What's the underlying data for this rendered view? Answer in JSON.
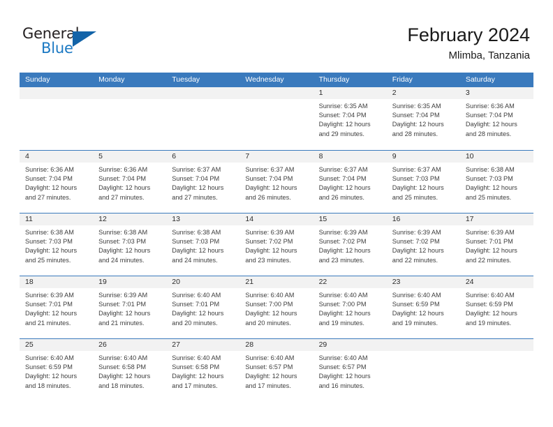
{
  "brand": {
    "name_top": "General",
    "name_bottom": "Blue",
    "triangle_icon": "triangle-icon",
    "color_dark": "#231f20",
    "color_blue": "#1b79c3"
  },
  "header": {
    "title": "February 2024",
    "subtitle": "Mlimba, Tanzania"
  },
  "theme": {
    "header_bg": "#3a7abd",
    "header_text": "#ffffff",
    "day_band_bg": "#f2f2f2",
    "cell_bg": "#ffffff",
    "grid_line": "#3a7abd"
  },
  "weekdays": [
    "Sunday",
    "Monday",
    "Tuesday",
    "Wednesday",
    "Thursday",
    "Friday",
    "Saturday"
  ],
  "weeks": [
    [
      {
        "day": "",
        "lines": []
      },
      {
        "day": "",
        "lines": []
      },
      {
        "day": "",
        "lines": []
      },
      {
        "day": "",
        "lines": []
      },
      {
        "day": "1",
        "lines": [
          "Sunrise: 6:35 AM",
          "Sunset: 7:04 PM",
          "Daylight: 12 hours",
          "and 29 minutes."
        ]
      },
      {
        "day": "2",
        "lines": [
          "Sunrise: 6:35 AM",
          "Sunset: 7:04 PM",
          "Daylight: 12 hours",
          "and 28 minutes."
        ]
      },
      {
        "day": "3",
        "lines": [
          "Sunrise: 6:36 AM",
          "Sunset: 7:04 PM",
          "Daylight: 12 hours",
          "and 28 minutes."
        ]
      }
    ],
    [
      {
        "day": "4",
        "lines": [
          "Sunrise: 6:36 AM",
          "Sunset: 7:04 PM",
          "Daylight: 12 hours",
          "and 27 minutes."
        ]
      },
      {
        "day": "5",
        "lines": [
          "Sunrise: 6:36 AM",
          "Sunset: 7:04 PM",
          "Daylight: 12 hours",
          "and 27 minutes."
        ]
      },
      {
        "day": "6",
        "lines": [
          "Sunrise: 6:37 AM",
          "Sunset: 7:04 PM",
          "Daylight: 12 hours",
          "and 27 minutes."
        ]
      },
      {
        "day": "7",
        "lines": [
          "Sunrise: 6:37 AM",
          "Sunset: 7:04 PM",
          "Daylight: 12 hours",
          "and 26 minutes."
        ]
      },
      {
        "day": "8",
        "lines": [
          "Sunrise: 6:37 AM",
          "Sunset: 7:04 PM",
          "Daylight: 12 hours",
          "and 26 minutes."
        ]
      },
      {
        "day": "9",
        "lines": [
          "Sunrise: 6:37 AM",
          "Sunset: 7:03 PM",
          "Daylight: 12 hours",
          "and 25 minutes."
        ]
      },
      {
        "day": "10",
        "lines": [
          "Sunrise: 6:38 AM",
          "Sunset: 7:03 PM",
          "Daylight: 12 hours",
          "and 25 minutes."
        ]
      }
    ],
    [
      {
        "day": "11",
        "lines": [
          "Sunrise: 6:38 AM",
          "Sunset: 7:03 PM",
          "Daylight: 12 hours",
          "and 25 minutes."
        ]
      },
      {
        "day": "12",
        "lines": [
          "Sunrise: 6:38 AM",
          "Sunset: 7:03 PM",
          "Daylight: 12 hours",
          "and 24 minutes."
        ]
      },
      {
        "day": "13",
        "lines": [
          "Sunrise: 6:38 AM",
          "Sunset: 7:03 PM",
          "Daylight: 12 hours",
          "and 24 minutes."
        ]
      },
      {
        "day": "14",
        "lines": [
          "Sunrise: 6:39 AM",
          "Sunset: 7:02 PM",
          "Daylight: 12 hours",
          "and 23 minutes."
        ]
      },
      {
        "day": "15",
        "lines": [
          "Sunrise: 6:39 AM",
          "Sunset: 7:02 PM",
          "Daylight: 12 hours",
          "and 23 minutes."
        ]
      },
      {
        "day": "16",
        "lines": [
          "Sunrise: 6:39 AM",
          "Sunset: 7:02 PM",
          "Daylight: 12 hours",
          "and 22 minutes."
        ]
      },
      {
        "day": "17",
        "lines": [
          "Sunrise: 6:39 AM",
          "Sunset: 7:01 PM",
          "Daylight: 12 hours",
          "and 22 minutes."
        ]
      }
    ],
    [
      {
        "day": "18",
        "lines": [
          "Sunrise: 6:39 AM",
          "Sunset: 7:01 PM",
          "Daylight: 12 hours",
          "and 21 minutes."
        ]
      },
      {
        "day": "19",
        "lines": [
          "Sunrise: 6:39 AM",
          "Sunset: 7:01 PM",
          "Daylight: 12 hours",
          "and 21 minutes."
        ]
      },
      {
        "day": "20",
        "lines": [
          "Sunrise: 6:40 AM",
          "Sunset: 7:01 PM",
          "Daylight: 12 hours",
          "and 20 minutes."
        ]
      },
      {
        "day": "21",
        "lines": [
          "Sunrise: 6:40 AM",
          "Sunset: 7:00 PM",
          "Daylight: 12 hours",
          "and 20 minutes."
        ]
      },
      {
        "day": "22",
        "lines": [
          "Sunrise: 6:40 AM",
          "Sunset: 7:00 PM",
          "Daylight: 12 hours",
          "and 19 minutes."
        ]
      },
      {
        "day": "23",
        "lines": [
          "Sunrise: 6:40 AM",
          "Sunset: 6:59 PM",
          "Daylight: 12 hours",
          "and 19 minutes."
        ]
      },
      {
        "day": "24",
        "lines": [
          "Sunrise: 6:40 AM",
          "Sunset: 6:59 PM",
          "Daylight: 12 hours",
          "and 19 minutes."
        ]
      }
    ],
    [
      {
        "day": "25",
        "lines": [
          "Sunrise: 6:40 AM",
          "Sunset: 6:59 PM",
          "Daylight: 12 hours",
          "and 18 minutes."
        ]
      },
      {
        "day": "26",
        "lines": [
          "Sunrise: 6:40 AM",
          "Sunset: 6:58 PM",
          "Daylight: 12 hours",
          "and 18 minutes."
        ]
      },
      {
        "day": "27",
        "lines": [
          "Sunrise: 6:40 AM",
          "Sunset: 6:58 PM",
          "Daylight: 12 hours",
          "and 17 minutes."
        ]
      },
      {
        "day": "28",
        "lines": [
          "Sunrise: 6:40 AM",
          "Sunset: 6:57 PM",
          "Daylight: 12 hours",
          "and 17 minutes."
        ]
      },
      {
        "day": "29",
        "lines": [
          "Sunrise: 6:40 AM",
          "Sunset: 6:57 PM",
          "Daylight: 12 hours",
          "and 16 minutes."
        ]
      },
      {
        "day": "",
        "lines": []
      },
      {
        "day": "",
        "lines": []
      }
    ]
  ]
}
